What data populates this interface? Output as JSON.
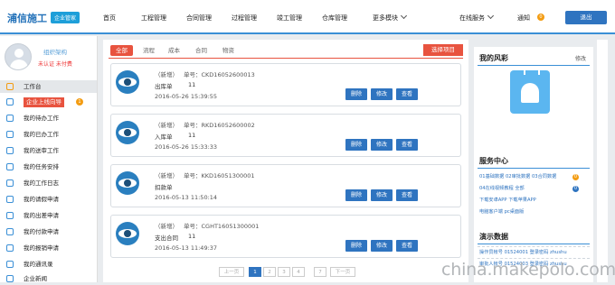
{
  "header": {
    "logo": "浦信施工",
    "badge": "企业管家",
    "nav": [
      "首页",
      "工程管理",
      "合同管理",
      "过程管理",
      "竣工管理",
      "仓库管理",
      "更多模块"
    ],
    "online_service": "在线服务",
    "notify": "通知",
    "notify_count": "0",
    "logout": "退出"
  },
  "sidebar": {
    "user_name": "组织架构",
    "user_status": "未认证  未付费",
    "items": [
      {
        "label": "工作台"
      },
      {
        "label": "企业上线向导",
        "badge": "1"
      },
      {
        "label": "我的待办工作"
      },
      {
        "label": "我的已办工作"
      },
      {
        "label": "我的送审工作"
      },
      {
        "label": "我的任务安排"
      },
      {
        "label": "我的工作日志"
      },
      {
        "label": "我的请假申请"
      },
      {
        "label": "我的出差申请"
      },
      {
        "label": "我的付款申请"
      },
      {
        "label": "我的报销申请"
      },
      {
        "label": "我的通讯录"
      },
      {
        "label": "企业新闻"
      }
    ]
  },
  "main": {
    "tabs": [
      "全部",
      "流程",
      "成本",
      "合同",
      "物资"
    ],
    "select_project": "选择项目",
    "buttons": {
      "delete": "删除",
      "edit": "修改",
      "view": "查看"
    },
    "records": [
      {
        "type": "（新增）",
        "number": "单号：CKD16052600013",
        "name": "出库单",
        "qty": "11",
        "time": "2016-05-26 15:39:55"
      },
      {
        "type": "（新增）",
        "number": "单号：RKD16052600002",
        "name": "入库单",
        "qty": "11",
        "time": "2016-05-26 15:33:33"
      },
      {
        "type": "（新增）",
        "number": "单号：KKD16051300001",
        "name": "扣款单",
        "qty": "",
        "time": "2016-05-13 11:50:14"
      },
      {
        "type": "（新增）",
        "number": "单号：CGHT16051300001",
        "name": "支出合同",
        "qty": "11",
        "time": "2016-05-13 11:49:37"
      }
    ],
    "pager": {
      "prev": "上一页",
      "pages": [
        "1",
        "2",
        "3",
        "4"
      ],
      "goto": "7",
      "next": "下一页"
    }
  },
  "right": {
    "style_title": "我的风彩",
    "edit": "修改",
    "service_title": "服务中心",
    "service_links": [
      "01基础数据 02审批数据 03合同数据",
      "04在线视频教程  全部",
      "下载安卓APP  下载苹果APP",
      "电脑客户端  pc桌面版"
    ],
    "service_badges": [
      "0",
      "0"
    ],
    "demo_title": "演示数据",
    "demo_rows": [
      "操作员帐号 01524001  登录密码 zhushu",
      "审批人帐号 01524003  登录密码 zhushu"
    ]
  },
  "watermark": "china.makepolo.com"
}
